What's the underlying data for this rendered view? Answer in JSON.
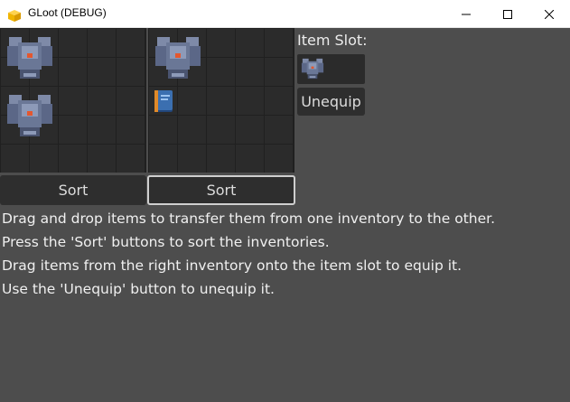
{
  "window": {
    "title": "GLoot (DEBUG)",
    "app_icon": "cube-icon",
    "controls": [
      "minimize-icon",
      "maximize-icon",
      "close-icon"
    ]
  },
  "inventories": [
    {
      "items": [
        {
          "type": "armor-icon"
        },
        {
          "type": "armor-icon"
        }
      ],
      "sort_label": "Sort"
    },
    {
      "items": [
        {
          "type": "armor-icon"
        },
        {
          "type": "book-icon"
        }
      ],
      "sort_label": "Sort"
    }
  ],
  "item_slot": {
    "label": "Item Slot:",
    "equipped": "armor-icon",
    "unequip_label": "Unequip"
  },
  "instructions": [
    "Drag and drop items to transfer them from one inventory to the other.",
    "Press the 'Sort' buttons to sort the inventories.",
    "Drag items from the right inventory onto the item slot to equip it.",
    "Use the 'Unequip' button to unequip it."
  ],
  "colors": {
    "background": "#4d4d4d",
    "grid_cell": "#2b2b2b",
    "button": "#2e2e2e",
    "armor": "#5f6f8c",
    "book": "#3b6fb0"
  }
}
